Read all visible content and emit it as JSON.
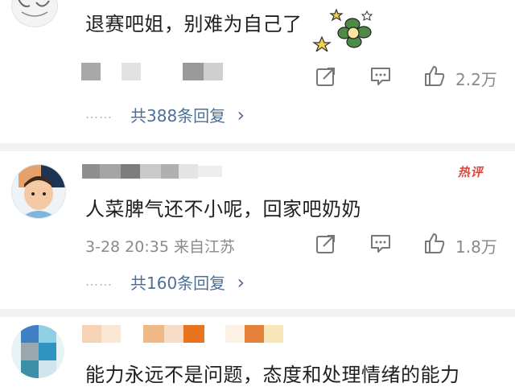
{
  "comments": [
    {
      "text": "退赛吧姐，别难为自己了",
      "likes": "2.2万",
      "replies": "共388条回复",
      "reply_chevron": "›",
      "dots": "……"
    },
    {
      "badge": "热评",
      "text": "人菜脾气还不小呢，回家吧奶奶",
      "meta": "3-28 20:35 来自江苏",
      "likes": "1.8万",
      "replies": "共160条回复",
      "reply_chevron": "›",
      "dots": "……"
    },
    {
      "text": "能力永远不是问题，态度和处理情绪的能力"
    }
  ],
  "icons": {
    "share": "share-icon",
    "comment": "comment-icon",
    "like": "thumbs-up-icon",
    "emoji": "flower-emoji-icon"
  },
  "colors": {
    "reply_link": "#4e6f96",
    "hot_badge": "#e0463b",
    "meta": "#8a8a8a",
    "divider": "#f2f2f2"
  }
}
